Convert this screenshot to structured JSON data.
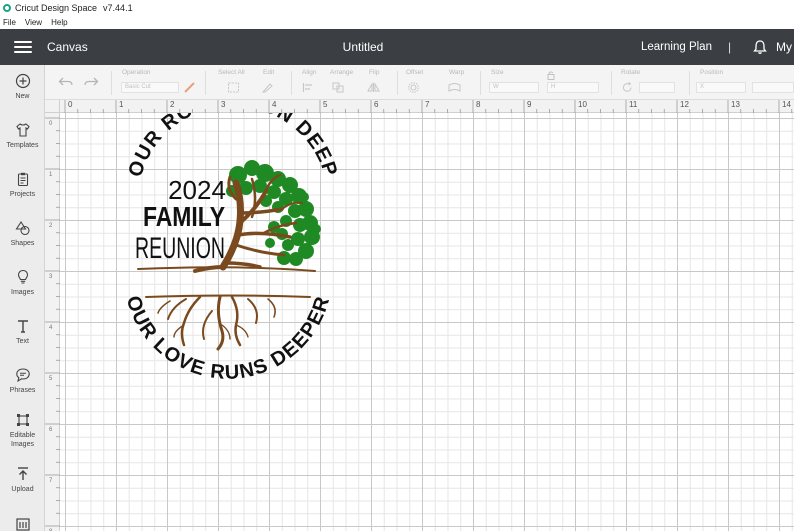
{
  "window": {
    "title": "Cricut Design Space",
    "version": "v7.44.1"
  },
  "menu": [
    "File",
    "View",
    "Help"
  ],
  "header": {
    "section": "Canvas",
    "document_title": "Untitled",
    "learning_plan": "Learning Plan",
    "separator": "|",
    "account": "My"
  },
  "sidebar": {
    "items": [
      {
        "label": "New",
        "icon": "plus-circle-icon"
      },
      {
        "label": "Templates",
        "icon": "shirt-icon"
      },
      {
        "label": "Projects",
        "icon": "clipboard-icon"
      },
      {
        "label": "Shapes",
        "icon": "shapes-icon"
      },
      {
        "label": "Images",
        "icon": "lightbulb-icon"
      },
      {
        "label": "Text",
        "icon": "text-icon"
      },
      {
        "label": "Phrases",
        "icon": "speech-bubble-icon"
      },
      {
        "label": "Editable Images",
        "icon": "editable-image-icon"
      },
      {
        "label": "Upload",
        "icon": "upload-icon"
      }
    ]
  },
  "toolbar": {
    "operation_label": "Operation",
    "operation_value": "Basic Cut",
    "select_all": "Select All",
    "edit": "Edit",
    "align": "Align",
    "arrange": "Arrange",
    "flip": "Flip",
    "offset": "Offset",
    "warp": "Warp",
    "size": "Size",
    "size_w": "W",
    "size_h": "H",
    "rotate": "Rotate",
    "position": "Position",
    "pos_x": "X"
  },
  "ruler": {
    "top_ticks": [
      "0",
      "1",
      "2",
      "3",
      "4",
      "5",
      "6",
      "7",
      "8",
      "9",
      "10",
      "11",
      "12",
      "13",
      "14"
    ],
    "left_ticks": [
      "0",
      "1",
      "2",
      "3",
      "4",
      "5",
      "6",
      "7",
      "8"
    ]
  },
  "design": {
    "arc_top": "OUR ROOTS RUN DEEP",
    "year": "2024",
    "line1": "FAMILY",
    "line2": "REUNION",
    "arc_bottom": "OUR LOVE RUNS DEEPER",
    "colors": {
      "trunk": "#7a4a1e",
      "leaves": "#1f8a23",
      "text": "#111111"
    }
  },
  "colors": {
    "header_bg": "#3b3f43",
    "sidebar_bg": "#ececec",
    "toolbar_bg": "#f4f4f4",
    "accent": "#1aa384"
  }
}
